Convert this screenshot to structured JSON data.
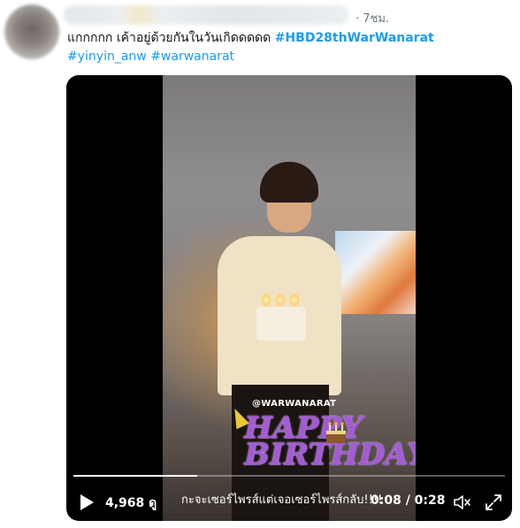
{
  "tweet": {
    "timestamp": "· 7ชม.",
    "text_line1": "แกกกกก เค้าอยู่ด้วยกันในวันเกิดดดดด",
    "hashtags_line1": [
      "#HBD28thWarWanarat"
    ],
    "hashtags_line2": [
      "#yinyin_anw",
      "#warwanarat"
    ]
  },
  "video": {
    "watermark": "@WARWANARAT",
    "sticker_text": [
      "HAPPY",
      "BIRTHDAY"
    ],
    "caption": "กะจะเซอร์ไพรส์แต่เจอเซอร์ไพรส์กลับ!!!!",
    "views": "4,968 ดู",
    "time_display": "0:08 / 0:28",
    "progress_percent": 28.6,
    "icons": [
      "play-icon",
      "volume-icon",
      "fullscreen-icon"
    ]
  },
  "colors": {
    "link": "#1d9bf0",
    "text": "#0f1419",
    "muted": "#6b7680"
  }
}
